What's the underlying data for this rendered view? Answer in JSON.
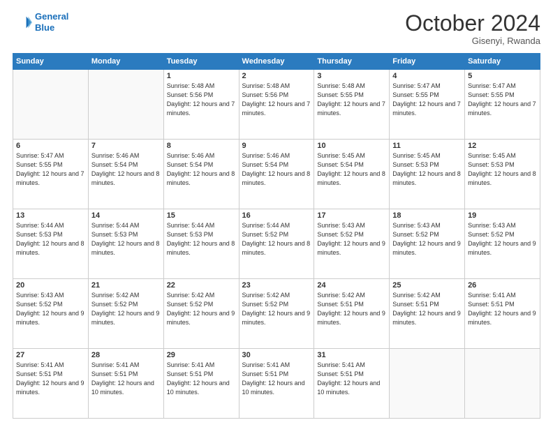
{
  "logo": {
    "line1": "General",
    "line2": "Blue"
  },
  "title": "October 2024",
  "subtitle": "Gisenyi, Rwanda",
  "days_header": [
    "Sunday",
    "Monday",
    "Tuesday",
    "Wednesday",
    "Thursday",
    "Friday",
    "Saturday"
  ],
  "weeks": [
    [
      {
        "day": "",
        "empty": true
      },
      {
        "day": "",
        "empty": true
      },
      {
        "day": "1",
        "sunrise": "5:48 AM",
        "sunset": "5:56 PM",
        "daylight": "12 hours and 7 minutes."
      },
      {
        "day": "2",
        "sunrise": "5:48 AM",
        "sunset": "5:56 PM",
        "daylight": "12 hours and 7 minutes."
      },
      {
        "day": "3",
        "sunrise": "5:48 AM",
        "sunset": "5:55 PM",
        "daylight": "12 hours and 7 minutes."
      },
      {
        "day": "4",
        "sunrise": "5:47 AM",
        "sunset": "5:55 PM",
        "daylight": "12 hours and 7 minutes."
      },
      {
        "day": "5",
        "sunrise": "5:47 AM",
        "sunset": "5:55 PM",
        "daylight": "12 hours and 7 minutes."
      }
    ],
    [
      {
        "day": "6",
        "sunrise": "5:47 AM",
        "sunset": "5:55 PM",
        "daylight": "12 hours and 7 minutes."
      },
      {
        "day": "7",
        "sunrise": "5:46 AM",
        "sunset": "5:54 PM",
        "daylight": "12 hours and 8 minutes."
      },
      {
        "day": "8",
        "sunrise": "5:46 AM",
        "sunset": "5:54 PM",
        "daylight": "12 hours and 8 minutes."
      },
      {
        "day": "9",
        "sunrise": "5:46 AM",
        "sunset": "5:54 PM",
        "daylight": "12 hours and 8 minutes."
      },
      {
        "day": "10",
        "sunrise": "5:45 AM",
        "sunset": "5:54 PM",
        "daylight": "12 hours and 8 minutes."
      },
      {
        "day": "11",
        "sunrise": "5:45 AM",
        "sunset": "5:53 PM",
        "daylight": "12 hours and 8 minutes."
      },
      {
        "day": "12",
        "sunrise": "5:45 AM",
        "sunset": "5:53 PM",
        "daylight": "12 hours and 8 minutes."
      }
    ],
    [
      {
        "day": "13",
        "sunrise": "5:44 AM",
        "sunset": "5:53 PM",
        "daylight": "12 hours and 8 minutes."
      },
      {
        "day": "14",
        "sunrise": "5:44 AM",
        "sunset": "5:53 PM",
        "daylight": "12 hours and 8 minutes."
      },
      {
        "day": "15",
        "sunrise": "5:44 AM",
        "sunset": "5:53 PM",
        "daylight": "12 hours and 8 minutes."
      },
      {
        "day": "16",
        "sunrise": "5:44 AM",
        "sunset": "5:52 PM",
        "daylight": "12 hours and 8 minutes."
      },
      {
        "day": "17",
        "sunrise": "5:43 AM",
        "sunset": "5:52 PM",
        "daylight": "12 hours and 9 minutes."
      },
      {
        "day": "18",
        "sunrise": "5:43 AM",
        "sunset": "5:52 PM",
        "daylight": "12 hours and 9 minutes."
      },
      {
        "day": "19",
        "sunrise": "5:43 AM",
        "sunset": "5:52 PM",
        "daylight": "12 hours and 9 minutes."
      }
    ],
    [
      {
        "day": "20",
        "sunrise": "5:43 AM",
        "sunset": "5:52 PM",
        "daylight": "12 hours and 9 minutes."
      },
      {
        "day": "21",
        "sunrise": "5:42 AM",
        "sunset": "5:52 PM",
        "daylight": "12 hours and 9 minutes."
      },
      {
        "day": "22",
        "sunrise": "5:42 AM",
        "sunset": "5:52 PM",
        "daylight": "12 hours and 9 minutes."
      },
      {
        "day": "23",
        "sunrise": "5:42 AM",
        "sunset": "5:52 PM",
        "daylight": "12 hours and 9 minutes."
      },
      {
        "day": "24",
        "sunrise": "5:42 AM",
        "sunset": "5:51 PM",
        "daylight": "12 hours and 9 minutes."
      },
      {
        "day": "25",
        "sunrise": "5:42 AM",
        "sunset": "5:51 PM",
        "daylight": "12 hours and 9 minutes."
      },
      {
        "day": "26",
        "sunrise": "5:41 AM",
        "sunset": "5:51 PM",
        "daylight": "12 hours and 9 minutes."
      }
    ],
    [
      {
        "day": "27",
        "sunrise": "5:41 AM",
        "sunset": "5:51 PM",
        "daylight": "12 hours and 9 minutes."
      },
      {
        "day": "28",
        "sunrise": "5:41 AM",
        "sunset": "5:51 PM",
        "daylight": "12 hours and 10 minutes."
      },
      {
        "day": "29",
        "sunrise": "5:41 AM",
        "sunset": "5:51 PM",
        "daylight": "12 hours and 10 minutes."
      },
      {
        "day": "30",
        "sunrise": "5:41 AM",
        "sunset": "5:51 PM",
        "daylight": "12 hours and 10 minutes."
      },
      {
        "day": "31",
        "sunrise": "5:41 AM",
        "sunset": "5:51 PM",
        "daylight": "12 hours and 10 minutes."
      },
      {
        "day": "",
        "empty": true
      },
      {
        "day": "",
        "empty": true
      }
    ]
  ]
}
